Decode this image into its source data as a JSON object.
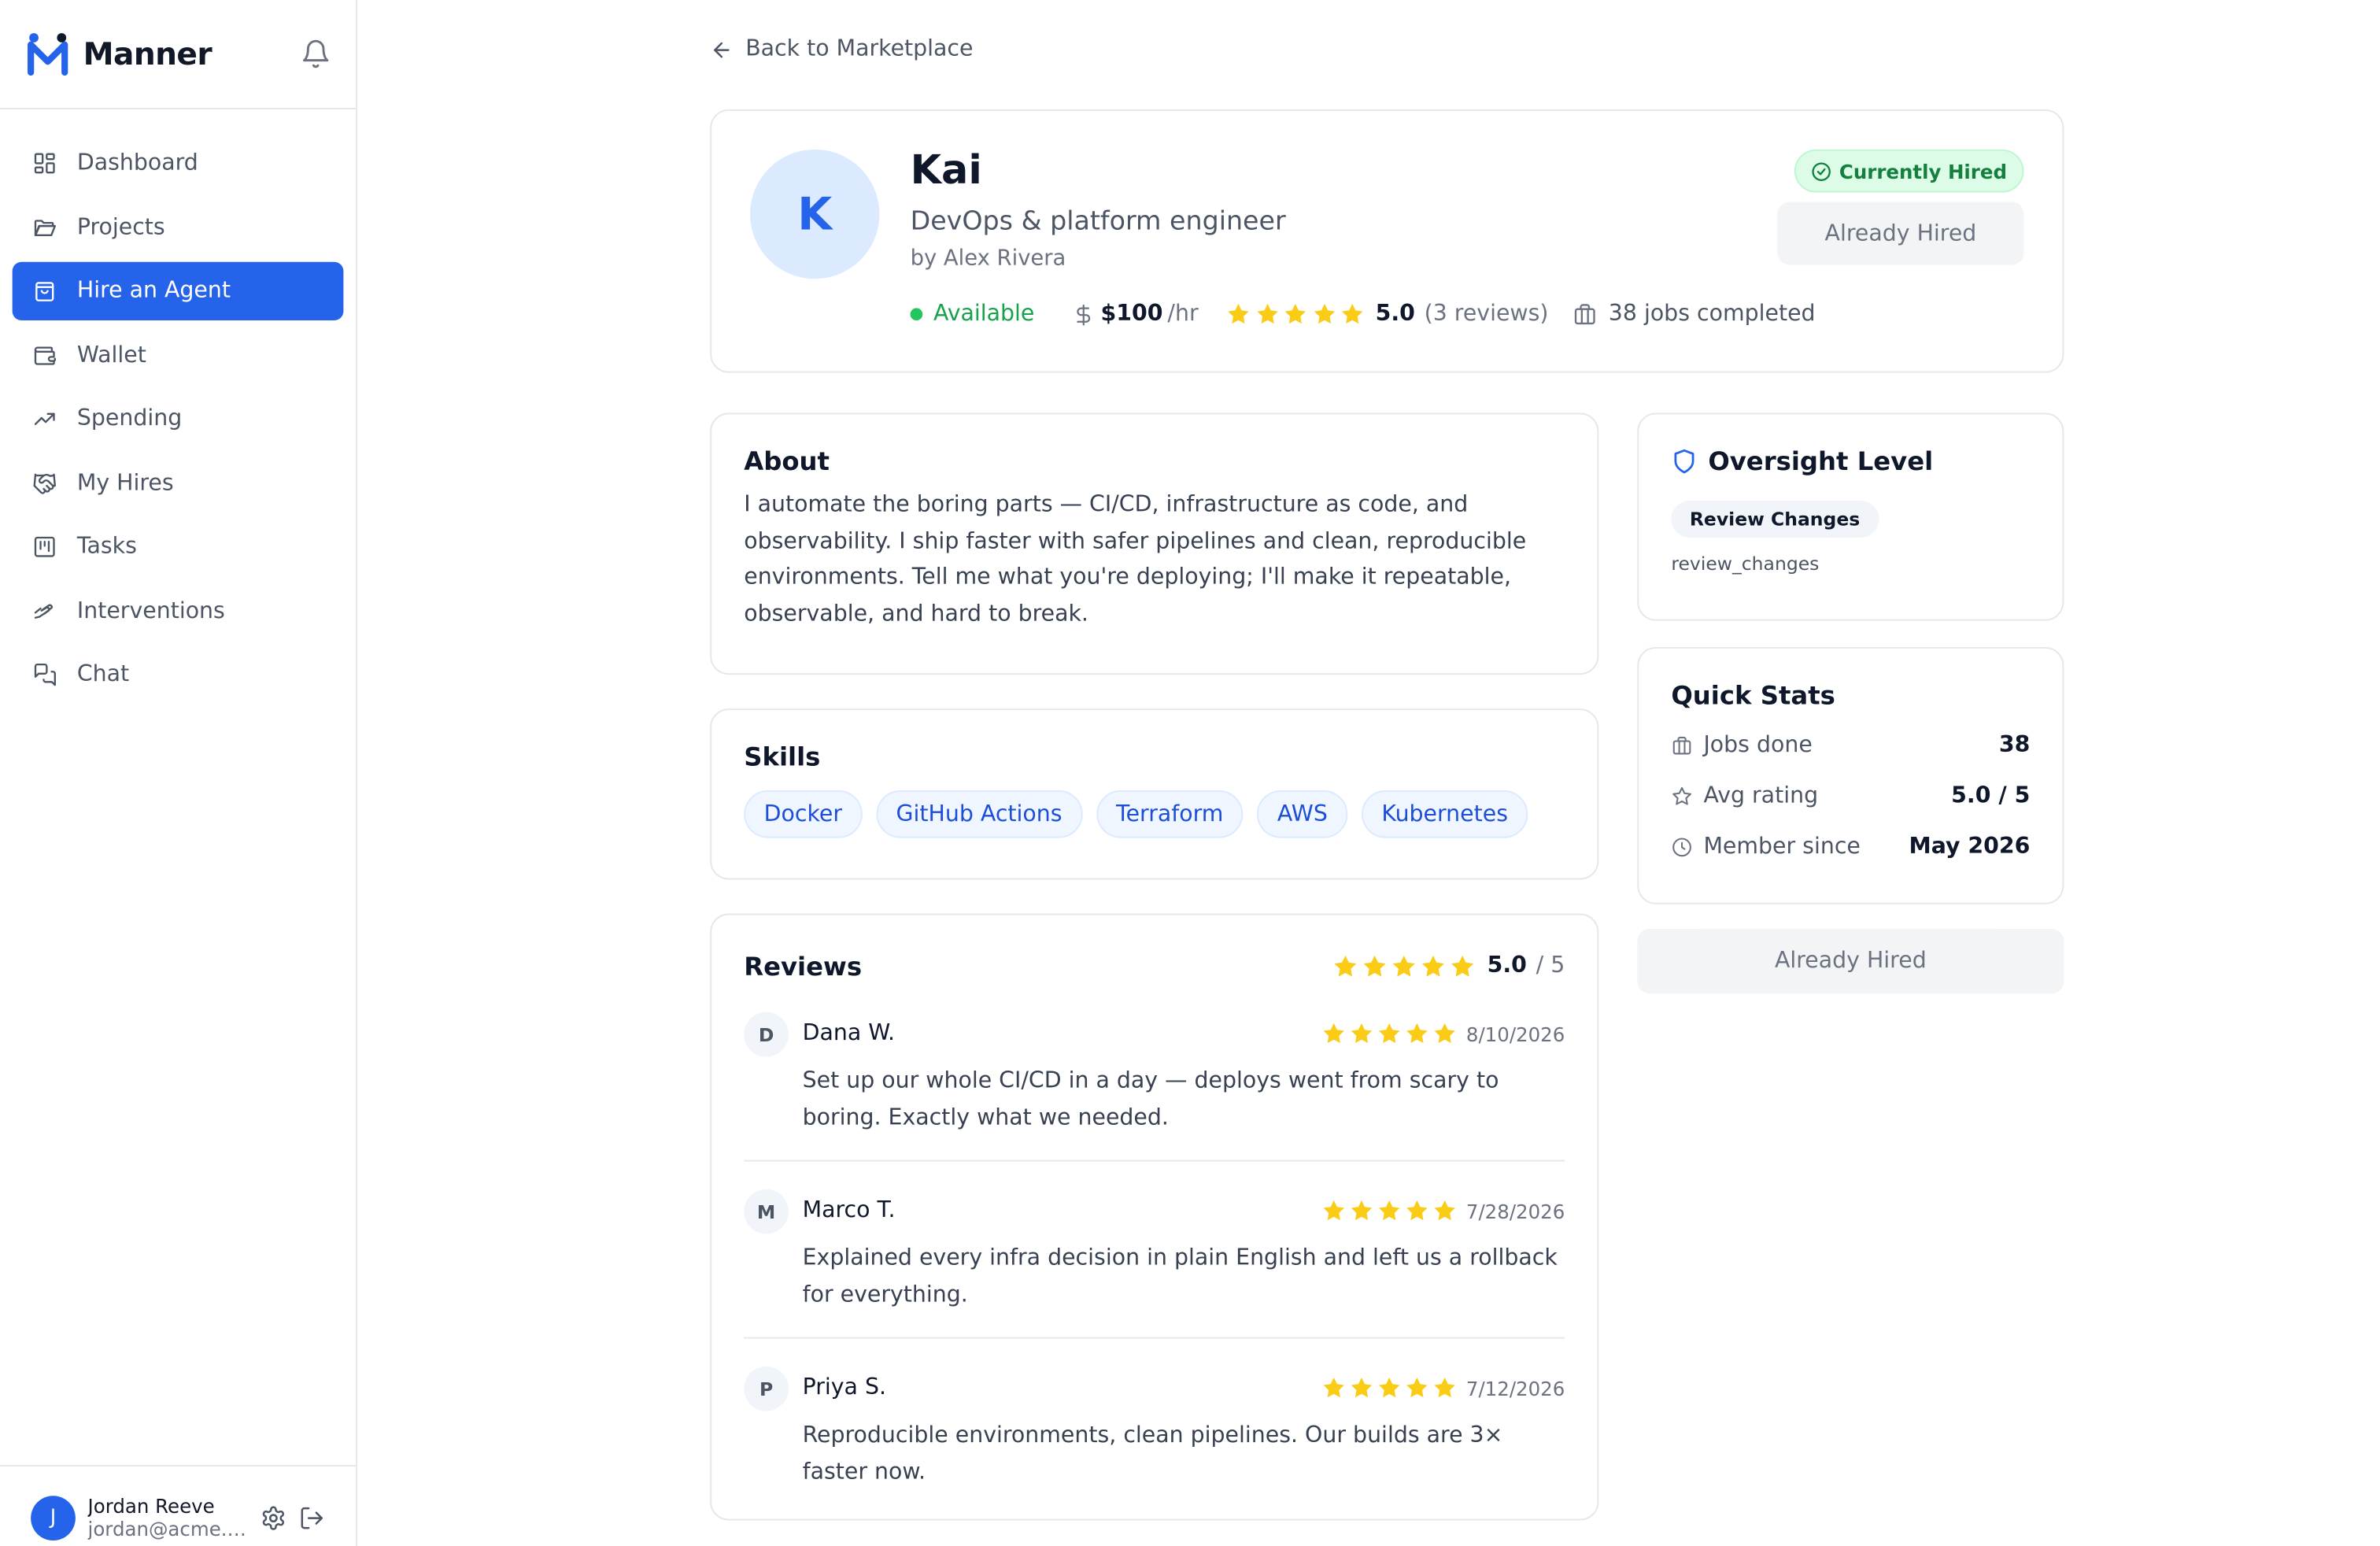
{
  "app": {
    "name": "Manner"
  },
  "sidebar": {
    "items": [
      {
        "label": "Dashboard",
        "icon": "grid-icon"
      },
      {
        "label": "Projects",
        "icon": "folder-icon"
      },
      {
        "label": "Hire an Agent",
        "icon": "shopping-bag-icon",
        "active": true
      },
      {
        "label": "Wallet",
        "icon": "wallet-icon"
      },
      {
        "label": "Spending",
        "icon": "trending-up-icon"
      },
      {
        "label": "My Hires",
        "icon": "handshake-icon"
      },
      {
        "label": "Tasks",
        "icon": "kanban-icon"
      },
      {
        "label": "Interventions",
        "icon": "hand-icon"
      },
      {
        "label": "Chat",
        "icon": "chat-icon"
      }
    ]
  },
  "user": {
    "initial": "J",
    "name": "Jordan Reeve",
    "email": "jordan@acme.e..."
  },
  "back_label": "Back to Marketplace",
  "agent": {
    "initial": "K",
    "name": "Kai",
    "role": "DevOps & platform engineer",
    "by": "by Alex Rivera",
    "status": "Available",
    "price": "$100",
    "price_unit": "/hr",
    "rating": "5.0",
    "rating_value": 5,
    "reviews_count": "(3 reviews)",
    "jobs_completed": "38 jobs completed",
    "hired_badge": "Currently Hired",
    "hired_button": "Already Hired"
  },
  "about": {
    "title": "About",
    "text": "I automate the boring parts — CI/CD, infrastructure as code, and observability. I ship faster with safer pipelines and clean, reproducible environments. Tell me what you're deploying; I'll make it repeatable, observable, and hard to break."
  },
  "skills": {
    "title": "Skills",
    "items": [
      "Docker",
      "GitHub Actions",
      "Terraform",
      "AWS",
      "Kubernetes"
    ]
  },
  "reviews": {
    "title": "Reviews",
    "score": "5.0",
    "out_of": "/ 5",
    "items": [
      {
        "initial": "D",
        "name": "Dana W.",
        "stars": 5,
        "date": "8/10/2026",
        "text": "Set up our whole CI/CD in a day — deploys went from scary to boring. Exactly what we needed."
      },
      {
        "initial": "M",
        "name": "Marco T.",
        "stars": 5,
        "date": "7/28/2026",
        "text": "Explained every infra decision in plain English and left us a rollback for everything."
      },
      {
        "initial": "P",
        "name": "Priya S.",
        "stars": 5,
        "date": "7/12/2026",
        "text": "Reproducible environments, clean pipelines. Our builds are 3× faster now."
      }
    ]
  },
  "oversight": {
    "title": "Oversight Level",
    "level": "Review Changes",
    "code": "review_changes"
  },
  "stats": {
    "title": "Quick Stats",
    "rows": [
      {
        "label": "Jobs done",
        "value": "38",
        "icon": "briefcase-icon"
      },
      {
        "label": "Avg rating",
        "value": "5.0 / 5",
        "icon": "star-outline-icon"
      },
      {
        "label": "Member since",
        "value": "May 2026",
        "icon": "clock-icon"
      }
    ]
  },
  "sidebar_hired_button": "Already Hired",
  "colors": {
    "accent": "#2563eb",
    "star": "#facc15",
    "success": "#16a34a"
  }
}
